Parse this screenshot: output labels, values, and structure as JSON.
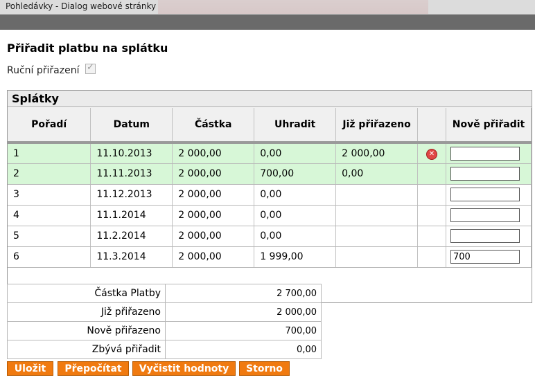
{
  "window": {
    "title": "Pohledávky - Dialog webové stránky"
  },
  "page": {
    "title": "Přiřadit platbu na splátku"
  },
  "manual_assign": {
    "label": "Ruční přiřazení",
    "checked": true
  },
  "grid": {
    "title": "Splátky",
    "columns": [
      "Pořadí",
      "Datum",
      "Částka",
      "Uhradit",
      "Již přiřazeno",
      "",
      "Nově přiřadit"
    ],
    "rows": [
      {
        "poradi": "1",
        "datum": "11.10.2013",
        "castka": "2 000,00",
        "uhradit": "0,00",
        "jiz": "2 000,00",
        "delete": true,
        "nove": "",
        "highlight": true
      },
      {
        "poradi": "2",
        "datum": "11.11.2013",
        "castka": "2 000,00",
        "uhradit": "700,00",
        "jiz": "0,00",
        "delete": false,
        "nove": "",
        "highlight": true
      },
      {
        "poradi": "3",
        "datum": "11.12.2013",
        "castka": "2 000,00",
        "uhradit": "0,00",
        "jiz": "",
        "delete": false,
        "nove": "",
        "highlight": false
      },
      {
        "poradi": "4",
        "datum": "11.1.2014",
        "castka": "2 000,00",
        "uhradit": "0,00",
        "jiz": "",
        "delete": false,
        "nove": "",
        "highlight": false
      },
      {
        "poradi": "5",
        "datum": "11.2.2014",
        "castka": "2 000,00",
        "uhradit": "0,00",
        "jiz": "",
        "delete": false,
        "nove": "",
        "highlight": false
      },
      {
        "poradi": "6",
        "datum": "11.3.2014",
        "castka": "2 000,00",
        "uhradit": "1 999,00",
        "jiz": "",
        "delete": false,
        "nove": "700",
        "highlight": false
      }
    ],
    "delete_icon": "remove-icon",
    "highlight_color": "#d7f7d7"
  },
  "summary": [
    {
      "label": "Částka Platby",
      "value": "2 700,00"
    },
    {
      "label": "Již přiřazeno",
      "value": "2 000,00"
    },
    {
      "label": "Nově přiřazeno",
      "value": "700,00"
    },
    {
      "label": "Zbývá přiřadit",
      "value": "0,00"
    }
  ],
  "buttons": {
    "save": "Uložit",
    "recalc": "Přepočítat",
    "clear": "Vyčistit hodnoty",
    "cancel": "Storno"
  },
  "colors": {
    "button_bg": "#f07a10",
    "header_bar": "#6a6a6a"
  }
}
